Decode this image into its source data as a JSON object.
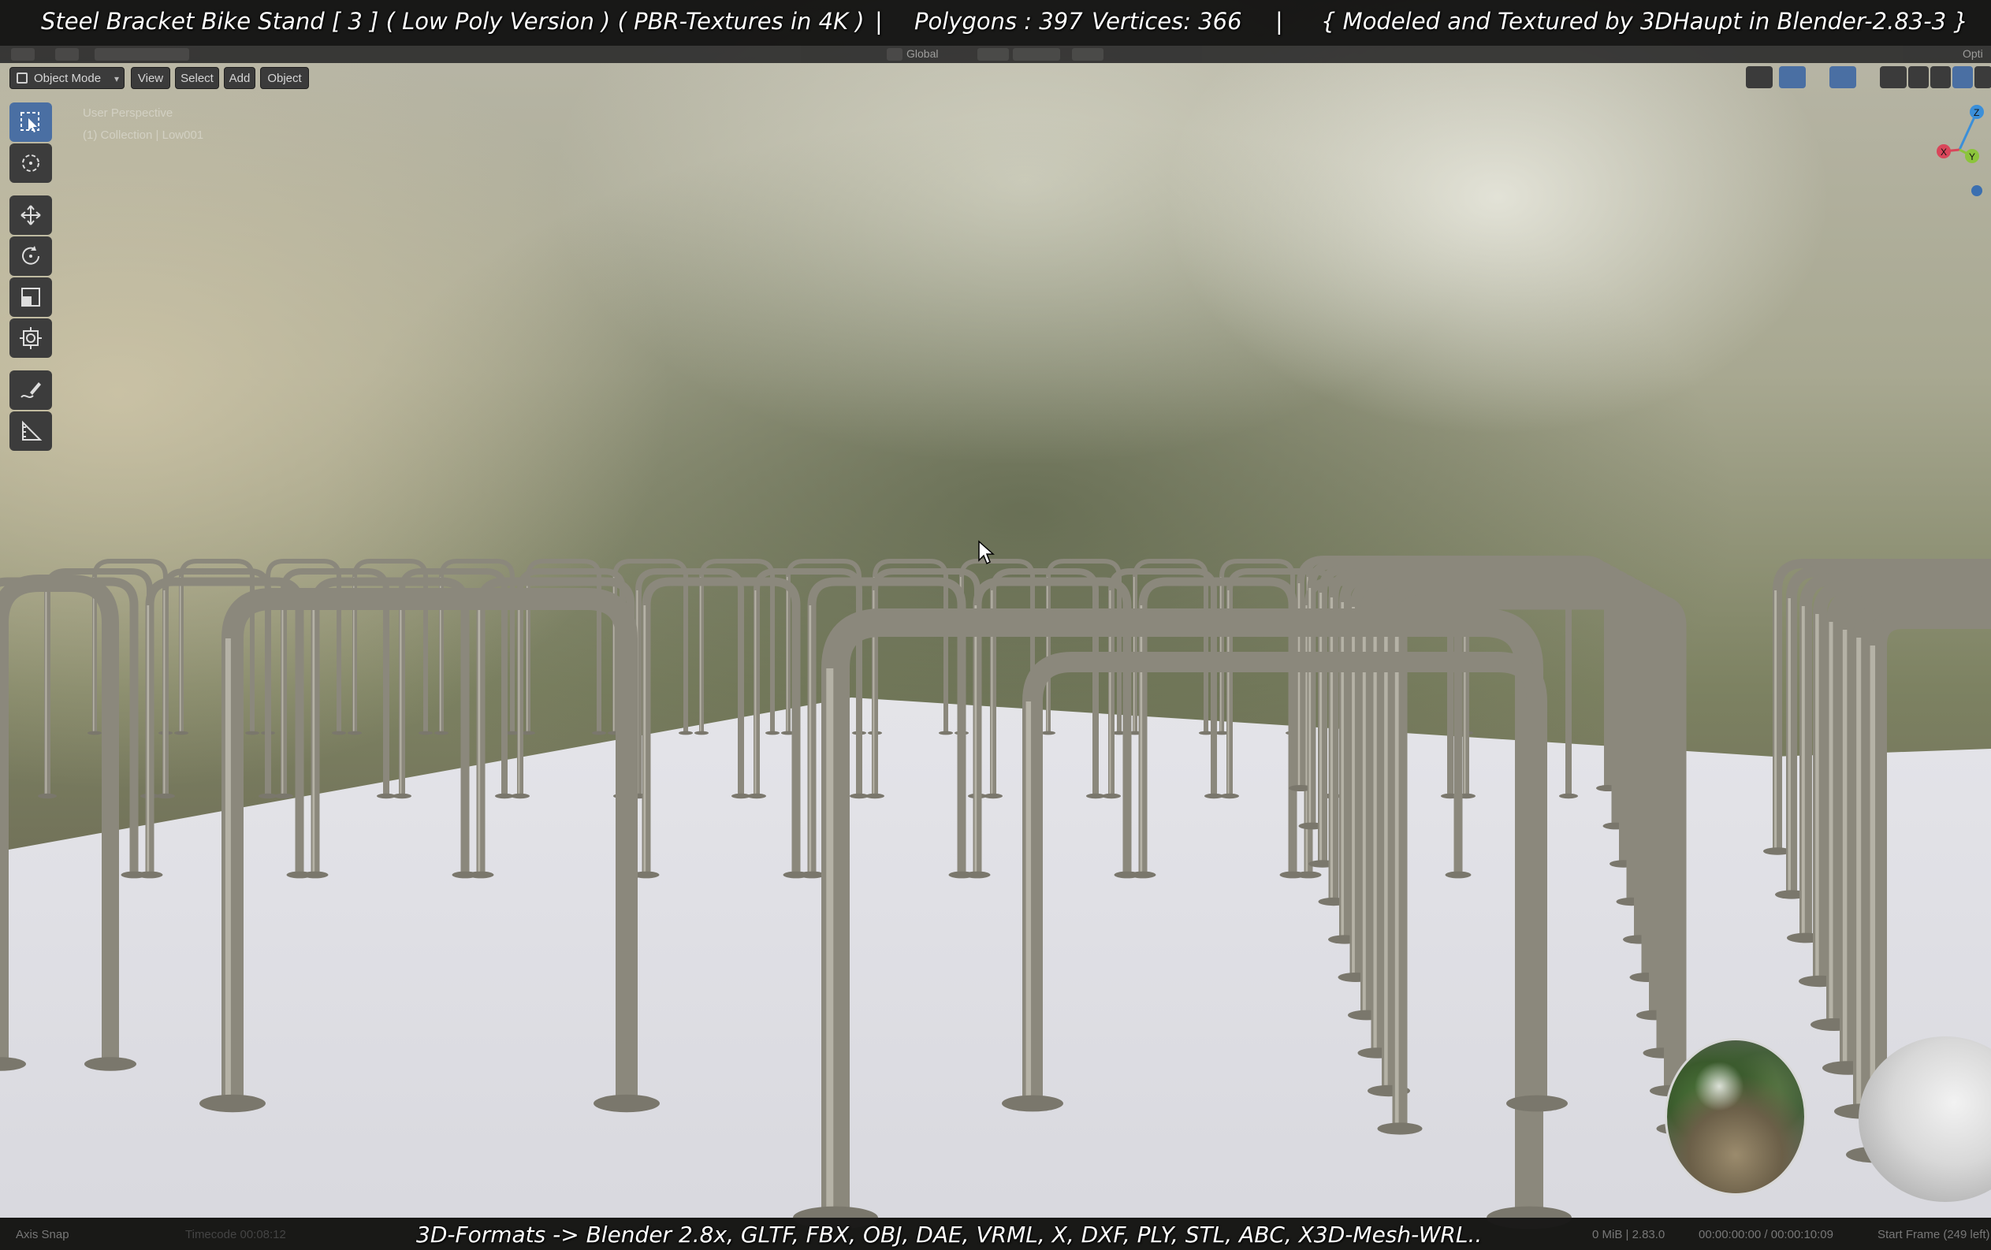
{
  "caption": {
    "title": "Steel Bracket Bike Stand [ 3 ] ( Low Poly Version ) ( PBR-Textures in 4K )",
    "separator": "|",
    "polygons": "Polygons : 397",
    "vertices": "Vertices: 366",
    "credit": "{ Modeled and Textured by 3DHaupt in Blender-2.83-3 }",
    "formats": "3D-Formats -> Blender 2.8x, GLTF, FBX, OBJ, DAE, VRML, X, DXF, PLY, STL, ABC, X3D-Mesh-WRL.."
  },
  "header": {
    "transform_orientation": "Global",
    "options": "Opti"
  },
  "viewport_header": {
    "mode": "Object Mode",
    "menus": [
      "View",
      "Select",
      "Add",
      "Object"
    ]
  },
  "viewport_overlay": {
    "perspective": "User Perspective",
    "collection": "(1) Collection | Low001"
  },
  "toolbar": {
    "tools": [
      {
        "icon": "select-box-icon",
        "active": true
      },
      {
        "icon": "cursor-icon",
        "active": false
      },
      {
        "icon": "move-icon",
        "active": false
      },
      {
        "icon": "rotate-icon",
        "active": false
      },
      {
        "icon": "scale-icon",
        "active": false
      },
      {
        "icon": "transform-icon",
        "active": false
      },
      {
        "icon": "annotate-icon",
        "active": false
      },
      {
        "icon": "measure-icon",
        "active": false
      }
    ]
  },
  "gizmo": {
    "x": "X",
    "y": "Y",
    "z": "Z"
  },
  "status_bar": {
    "left": "Axis Snap",
    "middle": "Timecode 00:08:12",
    "memory": "0 MiB | 2.83.0",
    "time": "00:00:00:00 / 00:00:10:09",
    "start": "Start Frame (249 left)"
  },
  "colors": {
    "accent": "#4a6fa3",
    "caption_bg": "#0c0c0c",
    "metal": "#8f8c80"
  }
}
